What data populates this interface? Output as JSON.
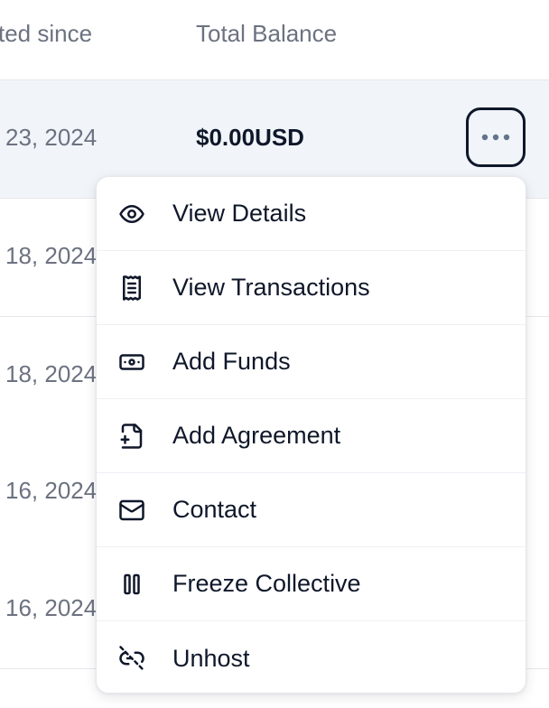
{
  "table": {
    "columns": {
      "since": "ted since",
      "balance": "Total Balance"
    },
    "rows": [
      {
        "date": "23, 2024",
        "balance": "$0.00USD"
      },
      {
        "date": "18, 2024",
        "balance": ""
      },
      {
        "date": "18, 2024",
        "balance": ""
      },
      {
        "date": "16, 2024",
        "balance": ""
      },
      {
        "date": "16, 2024",
        "balance": ""
      }
    ]
  },
  "menu": {
    "items": [
      {
        "label": "View Details",
        "icon": "eye-icon"
      },
      {
        "label": "View Transactions",
        "icon": "receipt-icon"
      },
      {
        "label": "Add Funds",
        "icon": "banknote-icon"
      },
      {
        "label": "Add Agreement",
        "icon": "file-plus-icon"
      },
      {
        "label": "Contact",
        "icon": "mail-icon"
      },
      {
        "label": "Freeze Collective",
        "icon": "pause-icon"
      },
      {
        "label": "Unhost",
        "icon": "unlink-icon"
      }
    ]
  },
  "colors": {
    "text": "#0f172a",
    "muted": "#6b7280",
    "active_row": "#f1f5f9",
    "border": "#e5e7eb"
  }
}
